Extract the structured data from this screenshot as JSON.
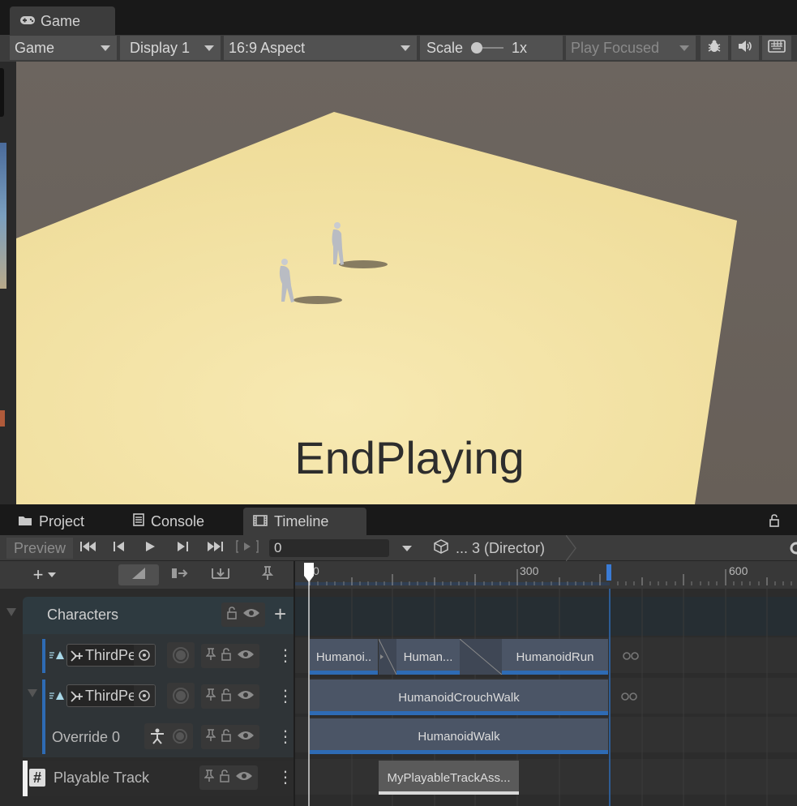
{
  "game_tab": {
    "label": "Game"
  },
  "toolbar": {
    "view_dropdown": "Game",
    "display_dropdown": "Display 1",
    "aspect_dropdown": "16:9 Aspect",
    "scale_label": "Scale",
    "scale_value": "1x",
    "play_mode_dropdown": "Play Focused"
  },
  "viewport": {
    "overlay_text": "EndPlaying",
    "ground_color": "#f4e4a6",
    "sky_color": "#6a635d"
  },
  "bottom_tabs": [
    {
      "label": "Project",
      "icon": "folder-icon"
    },
    {
      "label": "Console",
      "icon": "console-icon"
    },
    {
      "label": "Timeline",
      "icon": "film-icon"
    }
  ],
  "timeline": {
    "preview_label": "Preview",
    "frame_value": "0",
    "director_label": "... 3 (Director)",
    "ruler_ticks": [
      {
        "label": "0"
      },
      {
        "label": "300"
      },
      {
        "label": "600"
      }
    ],
    "tracks": {
      "group_label": "Characters",
      "anim1_label": "ThirdPe",
      "anim2_label": "ThirdPe",
      "override_label": "Override 0",
      "playable_label": "Playable Track"
    },
    "clips": {
      "row1": [
        "Humanoi..",
        "Human...",
        "HumanoidRun"
      ],
      "row2": "HumanoidCrouchWalk",
      "row3": "HumanoidWalk",
      "row4": "MyPlayableTrackAss..."
    },
    "accent_color": "#2e6bb4"
  }
}
